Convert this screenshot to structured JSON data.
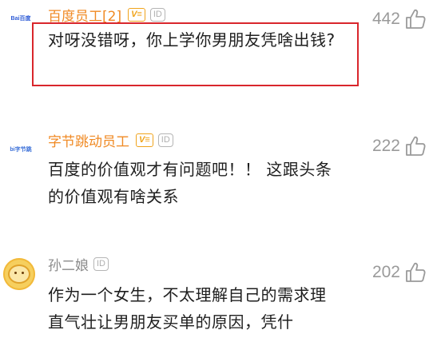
{
  "comments": [
    {
      "avatar_text": "Bai百度",
      "username": "百度员工[2]",
      "badge_v": "V≡",
      "badge_id": "ID",
      "text": "对呀没错呀，你上学你男朋友凭啥出钱?",
      "likes": "442"
    },
    {
      "avatar_text": "bi字节跳",
      "username": "字节跳动员工",
      "badge_v": "V≡",
      "badge_id": "ID",
      "text": "百度的价值观才有问题吧！！ 这跟头条的价值观有啥关系",
      "likes": "222"
    },
    {
      "username": "孙二娘",
      "badge_id": "ID",
      "text": "作为一个女生，不太理解自己的需求理直气壮让男朋友买单的原因，凭什",
      "likes": "202"
    }
  ],
  "colors": {
    "username_vip": "#f08a24",
    "username_normal": "#8a8a8a",
    "highlight": "#d9262c",
    "like": "#9a9a9a"
  },
  "icons": [
    "thumbs-up-icon"
  ]
}
